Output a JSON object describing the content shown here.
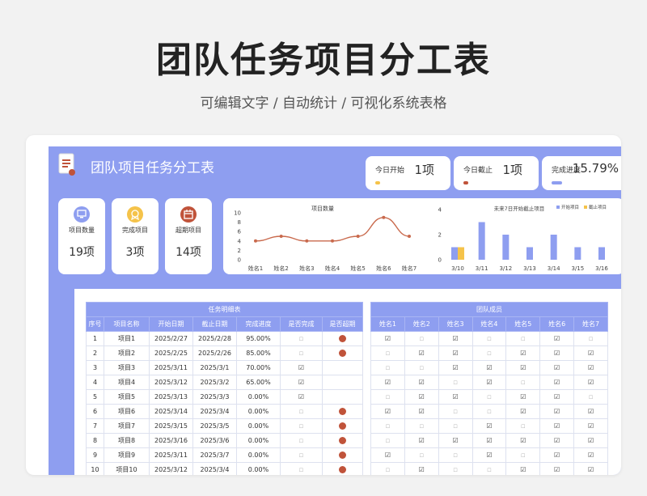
{
  "page": {
    "title": "团队任务项目分工表",
    "subtitle": "可编辑文字 / 自动统计 / 可视化系统表格"
  },
  "sheet": {
    "title": "团队项目任务分工表",
    "stats": [
      {
        "label": "今日开始",
        "value": "1项",
        "progress": 0.08,
        "color": "#f5c34a"
      },
      {
        "label": "今日截止",
        "value": "1项",
        "progress": 0.08,
        "color": "#c0533a"
      },
      {
        "label": "完成进度",
        "value": "15.79%",
        "progress": 0.1579,
        "color": "#8e9ef0"
      }
    ],
    "kpis": [
      {
        "label": "项目数量",
        "value": "19项",
        "icon": "monitor-icon",
        "color": "#8e9ef0"
      },
      {
        "label": "完成项目",
        "value": "3项",
        "icon": "medal-icon",
        "color": "#f5c34a"
      },
      {
        "label": "超期项目",
        "value": "14项",
        "icon": "calendar-icon",
        "color": "#c0533a"
      }
    ]
  },
  "colors": {
    "primary": "#8e9ef0",
    "line": "#c96a4d",
    "start": "#8e9ef0",
    "end": "#f5c34a",
    "overdue": "#c0533a"
  },
  "chart_data": [
    {
      "type": "line",
      "title": "项目数量",
      "categories": [
        "姓名1",
        "姓名2",
        "姓名3",
        "姓名4",
        "姓名5",
        "姓名6",
        "姓名7"
      ],
      "values": [
        4,
        5,
        4,
        4,
        5,
        9,
        5
      ],
      "ylim": [
        0,
        10
      ],
      "yticks": [
        0,
        2,
        4,
        6,
        8,
        10
      ]
    },
    {
      "type": "bar",
      "title": "未来7日开始截止项目",
      "categories": [
        "3/10",
        "3/11",
        "3/12",
        "3/13",
        "3/14",
        "3/15",
        "3/16"
      ],
      "series": [
        {
          "name": "开始项目",
          "values": [
            1,
            3,
            2,
            1,
            2,
            1,
            1
          ]
        },
        {
          "name": "截止项目",
          "values": [
            1,
            0,
            0,
            0,
            0,
            0,
            0
          ]
        }
      ],
      "ylim": [
        0,
        4
      ],
      "yticks": [
        0,
        2,
        4
      ],
      "legend": "top-right"
    }
  ],
  "task_table": {
    "group_header": "任务明细表",
    "columns": [
      "序号",
      "项目名称",
      "开始日期",
      "截止日期",
      "完成进度",
      "是否完成",
      "是否超期"
    ],
    "rows": [
      {
        "no": "1",
        "name": "项目1",
        "start": "2025/2/27",
        "end": "2025/2/28",
        "progress": "95.00%",
        "done": false,
        "overdue": true
      },
      {
        "no": "2",
        "name": "项目2",
        "start": "2025/2/25",
        "end": "2025/2/26",
        "progress": "85.00%",
        "done": false,
        "overdue": true
      },
      {
        "no": "3",
        "name": "项目3",
        "start": "2025/3/11",
        "end": "2025/3/1",
        "progress": "70.00%",
        "done": true,
        "overdue": false
      },
      {
        "no": "4",
        "name": "项目4",
        "start": "2025/3/12",
        "end": "2025/3/2",
        "progress": "65.00%",
        "done": true,
        "overdue": false
      },
      {
        "no": "5",
        "name": "项目5",
        "start": "2025/3/13",
        "end": "2025/3/3",
        "progress": "0.00%",
        "done": true,
        "overdue": false
      },
      {
        "no": "6",
        "name": "项目6",
        "start": "2025/3/14",
        "end": "2025/3/4",
        "progress": "0.00%",
        "done": false,
        "overdue": true
      },
      {
        "no": "7",
        "name": "项目7",
        "start": "2025/3/15",
        "end": "2025/3/5",
        "progress": "0.00%",
        "done": false,
        "overdue": true
      },
      {
        "no": "8",
        "name": "项目8",
        "start": "2025/3/16",
        "end": "2025/3/6",
        "progress": "0.00%",
        "done": false,
        "overdue": true
      },
      {
        "no": "9",
        "name": "项目9",
        "start": "2025/3/11",
        "end": "2025/3/7",
        "progress": "0.00%",
        "done": false,
        "overdue": true
      },
      {
        "no": "10",
        "name": "项目10",
        "start": "2025/3/12",
        "end": "2025/3/4",
        "progress": "0.00%",
        "done": false,
        "overdue": true
      }
    ]
  },
  "member_table": {
    "group_header": "团队成员",
    "columns": [
      "姓名1",
      "姓名2",
      "姓名3",
      "姓名4",
      "姓名5",
      "姓名6",
      "姓名7"
    ],
    "rows": [
      [
        1,
        0,
        1,
        0,
        0,
        1,
        0
      ],
      [
        0,
        1,
        1,
        0,
        1,
        1,
        1
      ],
      [
        0,
        0,
        1,
        1,
        1,
        1,
        1
      ],
      [
        1,
        1,
        0,
        1,
        0,
        1,
        1
      ],
      [
        0,
        1,
        1,
        0,
        1,
        1,
        0
      ],
      [
        1,
        1,
        0,
        0,
        1,
        1,
        1
      ],
      [
        0,
        0,
        0,
        1,
        0,
        1,
        1
      ],
      [
        0,
        1,
        1,
        1,
        1,
        1,
        1
      ],
      [
        1,
        0,
        0,
        1,
        0,
        1,
        1
      ],
      [
        0,
        1,
        0,
        0,
        1,
        1,
        1
      ]
    ]
  }
}
